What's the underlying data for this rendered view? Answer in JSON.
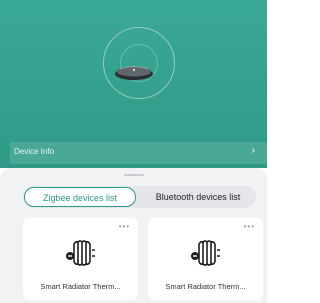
{
  "hero": {
    "device_info_label": "Device Info",
    "chevron_icon": "chevron-right-icon",
    "hub_icon": "zigbee-gateway-hub-icon"
  },
  "tabs": {
    "zigbee_label": "Zigbee devices list",
    "bluetooth_label": "Bluetooth devices list",
    "active": "zigbee"
  },
  "devices": [
    {
      "name": "Smart Radiator Therm...",
      "icon": "radiator-thermostat-icon",
      "menu_icon": "more-dots-icon"
    },
    {
      "name": "Smart Radiator Therm...",
      "icon": "radiator-thermostat-icon",
      "menu_icon": "more-dots-icon"
    }
  ],
  "colors": {
    "accent": "#2f9a87",
    "hero_bg": "#3aa995",
    "sheet_bg": "#f1f2f4"
  }
}
